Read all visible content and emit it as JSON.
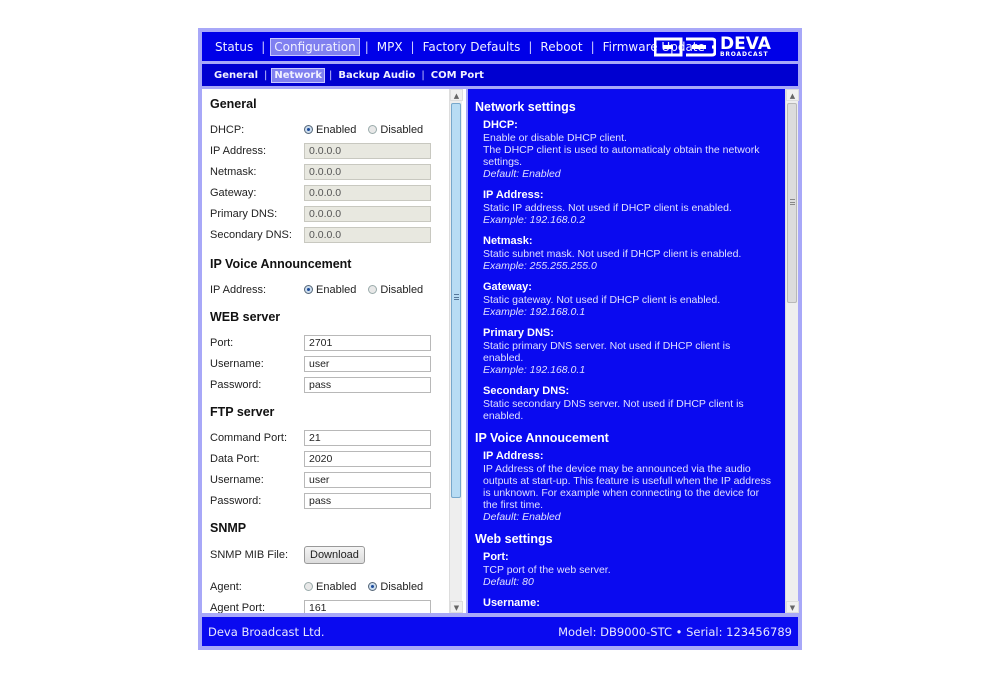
{
  "topnav": {
    "items": [
      {
        "label": "Status",
        "active": false
      },
      {
        "label": "Configuration",
        "active": true
      },
      {
        "label": "MPX",
        "active": false
      },
      {
        "label": "Factory Defaults",
        "active": false
      },
      {
        "label": "Reboot",
        "active": false
      },
      {
        "label": "Firmware Update",
        "active": false
      }
    ],
    "separator": "|"
  },
  "logo": {
    "brand": "DEVA",
    "sub": "BROADCAST",
    "registered": "®"
  },
  "subnav": {
    "items": [
      {
        "label": "General",
        "active": false
      },
      {
        "label": "Network",
        "active": true
      },
      {
        "label": "Backup Audio",
        "active": false
      },
      {
        "label": "COM Port",
        "active": false
      }
    ],
    "separator": "|"
  },
  "form": {
    "general": {
      "title": "General",
      "dhcp_label": "DHCP:",
      "enabled_label": "Enabled",
      "disabled_label": "Disabled",
      "dhcp_value": "Enabled",
      "fields": [
        {
          "label": "IP Address:",
          "value": "0.0.0.0"
        },
        {
          "label": "Netmask:",
          "value": "0.0.0.0"
        },
        {
          "label": "Gateway:",
          "value": "0.0.0.0"
        },
        {
          "label": "Primary DNS:",
          "value": "0.0.0.0"
        },
        {
          "label": "Secondary DNS:",
          "value": "0.0.0.0"
        }
      ]
    },
    "ip_voice": {
      "title": "IP Voice Announcement",
      "label": "IP Address:",
      "enabled_label": "Enabled",
      "disabled_label": "Disabled",
      "value": "Enabled"
    },
    "web": {
      "title": "WEB server",
      "fields": [
        {
          "label": "Port:",
          "value": "2701"
        },
        {
          "label": "Username:",
          "value": "user"
        },
        {
          "label": "Password:",
          "value": "pass"
        }
      ]
    },
    "ftp": {
      "title": "FTP server",
      "fields": [
        {
          "label": "Command Port:",
          "value": "21"
        },
        {
          "label": "Data Port:",
          "value": "2020"
        },
        {
          "label": "Username:",
          "value": "user"
        },
        {
          "label": "Password:",
          "value": "pass"
        }
      ]
    },
    "snmp": {
      "title": "SNMP",
      "mib_label": "SNMP MIB File:",
      "download_label": "Download",
      "agent_label": "Agent:",
      "enabled_label": "Enabled",
      "disabled_label": "Disabled",
      "agent_value": "Disabled",
      "agent_port_label": "Agent Port:",
      "agent_port_value": "161"
    }
  },
  "help": {
    "network_title": "Network settings",
    "dhcp": {
      "title": "DHCP:",
      "line1": "Enable or disable DHCP client.",
      "line2": "The DHCP client is used to automaticaly obtain the network settings.",
      "default": "Default: Enabled"
    },
    "ip": {
      "title": "IP Address:",
      "text": "Static IP address. Not used if DHCP client is enabled.",
      "example": "Example: 192.168.0.2"
    },
    "netmask": {
      "title": "Netmask:",
      "text": "Static subnet mask. Not used if DHCP client is enabled.",
      "example": "Example: 255.255.255.0"
    },
    "gateway": {
      "title": "Gateway:",
      "text": "Static gateway. Not used if DHCP client is enabled.",
      "example": "Example: 192.168.0.1"
    },
    "pdns": {
      "title": "Primary DNS:",
      "text": "Static primary DNS server. Not used if DHCP client is enabled.",
      "example": "Example: 192.168.0.1"
    },
    "sdns": {
      "title": "Secondary DNS:",
      "text": "Static secondary DNS server. Not used if DHCP client is enabled."
    },
    "voice_title": "IP Voice Annoucement",
    "voice_ip": {
      "title": "IP Address:",
      "text": "IP Address of the device may be announced via the audio outputs at start-up. This feature is usefull when the IP address is unknown. For example when connecting to the device for the first time.",
      "default": "Default: Enabled"
    },
    "web_title": "Web settings",
    "web_port": {
      "title": "Port:",
      "text": "TCP port of the web server.",
      "default": "Default: 80"
    },
    "web_user": {
      "title": "Username:"
    }
  },
  "footer": {
    "company": "Deva Broadcast Ltd.",
    "model_info": "Model: DB9000-STC • Serial: 123456789"
  }
}
